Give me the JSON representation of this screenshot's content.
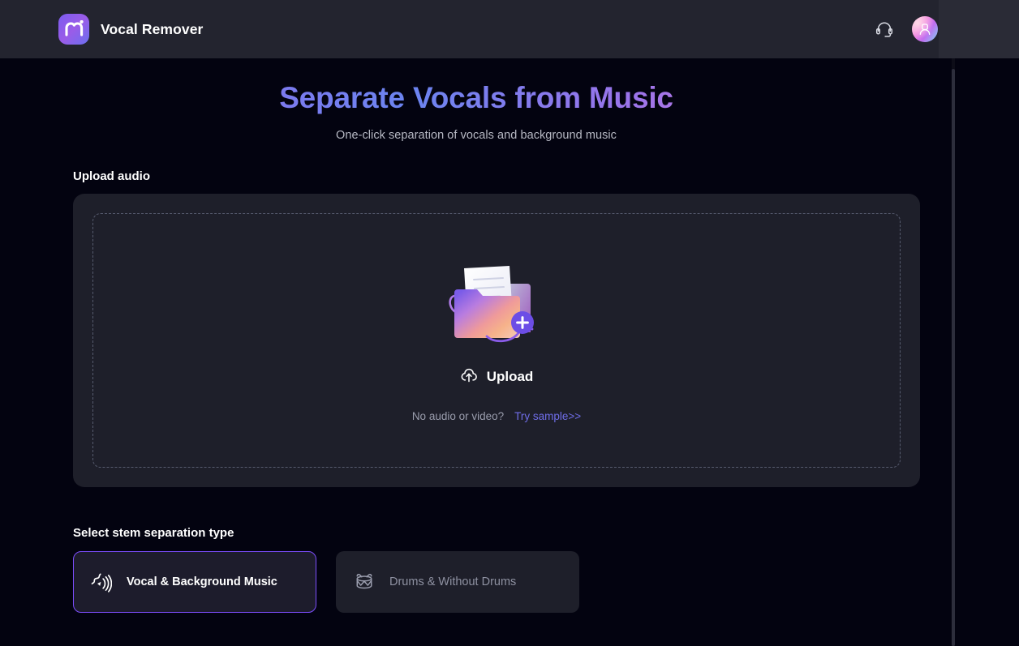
{
  "header": {
    "logo_icon": "m-logo-icon",
    "brand_name": "Vocal Remover",
    "support_icon": "headset-support-icon",
    "avatar_icon": "user-avatar-icon"
  },
  "hero": {
    "title": "Separate Vocals from Music",
    "subtitle": "One-click separation of vocals and background music"
  },
  "upload": {
    "section_label": "Upload audio",
    "illustration_icon": "folder-upload-illustration",
    "plus_badge_icon": "plus-icon",
    "upload_icon": "cloud-upload-icon",
    "upload_label": "Upload",
    "hint_text": "No audio or video?",
    "sample_link": "Try sample>>"
  },
  "stem": {
    "section_label": "Select stem separation type",
    "options": [
      {
        "label": "Vocal & Background Music",
        "icon": "vocal-waves-icon",
        "selected": true
      },
      {
        "label": "Drums & Without Drums",
        "icon": "drum-icon",
        "selected": false
      }
    ]
  },
  "colors": {
    "page_bg": "#030310",
    "header_bg": "#23242f",
    "panel_bg": "#1e1f2a",
    "accent_purple": "#7b4dfb",
    "link_purple": "#6f6de8",
    "dashed_border": "#565b6e",
    "title_gradient_start": "#9a6ae8",
    "title_gradient_mid": "#6b84f0",
    "title_gradient_end": "#df82dc",
    "muted_text": "#9a9dad"
  }
}
